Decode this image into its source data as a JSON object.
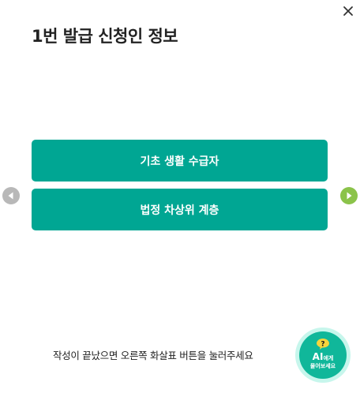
{
  "dialog": {
    "title": "1번 발급 신청인 정보",
    "close_icon": "close-icon"
  },
  "options": [
    {
      "label": "기초 생활 수급자"
    },
    {
      "label": "법정 차상위 계층"
    }
  ],
  "navigation": {
    "prev_icon": "arrow-left-icon",
    "next_icon": "arrow-right-icon",
    "prev_color": "#b8b8b8",
    "next_color": "#8bc34a"
  },
  "instruction": "작성이 끝났으면 오른쪽 화살표 버튼을 눌러주세요",
  "ai_help": {
    "icon": "question-bubble-icon",
    "label_main": "AI",
    "label_suffix": "에게",
    "label_sub": "물어보세요"
  },
  "colors": {
    "accent": "#00a693",
    "text": "#222222",
    "ai_bubble": "#f6d43c"
  }
}
